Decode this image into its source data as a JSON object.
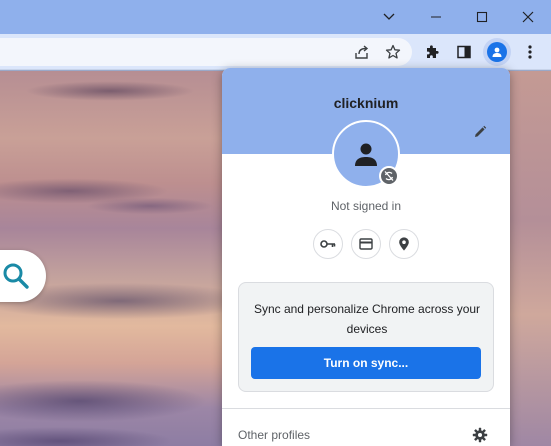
{
  "window": {
    "controls": [
      {
        "name": "tab-search-button",
        "icon": "chevron-down-icon"
      },
      {
        "name": "minimize-button",
        "icon": "minimize-icon"
      },
      {
        "name": "maximize-button",
        "icon": "maximize-icon"
      },
      {
        "name": "close-button",
        "icon": "close-icon"
      }
    ]
  },
  "toolbar": {
    "icons": [
      "share-icon",
      "star-icon",
      "extensions-icon",
      "side-panel-icon",
      "profile-icon",
      "more-vert-icon"
    ]
  },
  "profile_menu": {
    "name": "clicknium",
    "status": "Not signed in",
    "quick_actions": [
      "key-icon",
      "credit-card-icon",
      "location-pin-icon"
    ],
    "sync_card": {
      "text": "Sync and personalize Chrome across your devices",
      "button_label": "Turn on sync..."
    },
    "other_profiles_label": "Other profiles"
  },
  "colors": {
    "header_blue": "#8fb0ec",
    "accent": "#1a73e8",
    "toolbar": "#dbe6fb"
  }
}
